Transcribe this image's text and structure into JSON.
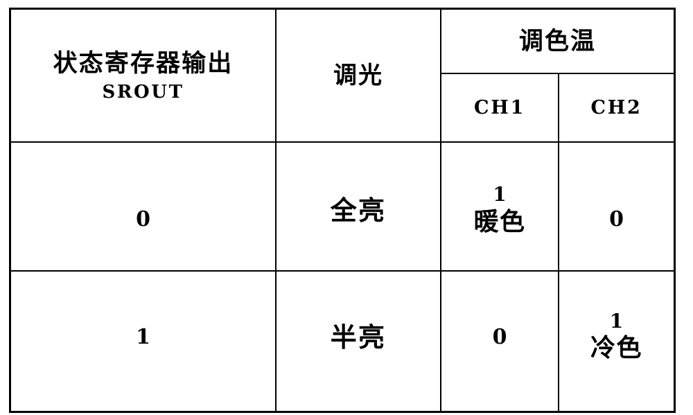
{
  "document": {
    "type": "scanned-table",
    "background_color": "#ffffff",
    "ink_color": "#000000"
  },
  "table": {
    "header": {
      "col_srout": {
        "line1": "状态寄存器输出",
        "line2": "SROUT"
      },
      "col_dimming": "调光",
      "group_cct": "调色温",
      "col_ch1": "CH1",
      "col_ch2": "CH2"
    },
    "rows": [
      {
        "srout": "0",
        "dimming": "全亮",
        "ch1_value": "1",
        "ch1_label": "暖色",
        "ch2_value": "0",
        "ch2_label": ""
      },
      {
        "srout": "1",
        "dimming": "半亮",
        "ch1_value": "0",
        "ch1_label": "",
        "ch2_value": "1",
        "ch2_label": "冷色"
      }
    ]
  }
}
